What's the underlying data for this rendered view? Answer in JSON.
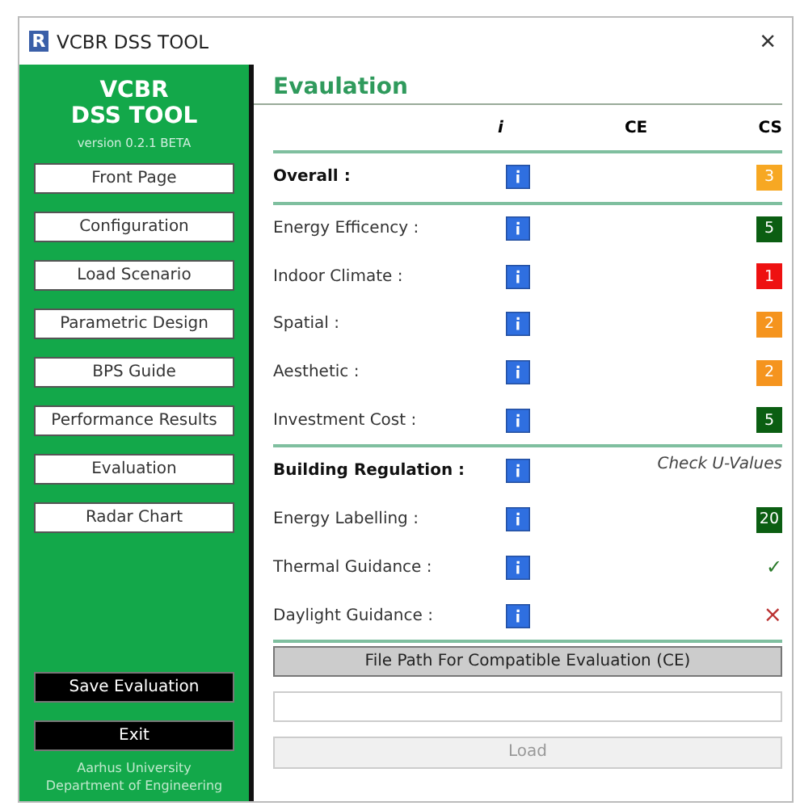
{
  "window": {
    "title": "VCBR DSS TOOL",
    "app_letter": "R",
    "close": "×"
  },
  "sidebar": {
    "title_lines": [
      "VCBR",
      "DSS TOOL"
    ],
    "version": "version 0.2.1 BETA",
    "items": [
      {
        "label": "Front Page"
      },
      {
        "label": "Configuration"
      },
      {
        "label": "Load Scenario"
      },
      {
        "label": "Parametric Design"
      },
      {
        "label": "BPS Guide"
      },
      {
        "label": "Performance Results"
      },
      {
        "label": "Evaluation"
      },
      {
        "label": "Radar Chart"
      }
    ],
    "actions": [
      "Save Evaluation",
      "Exit"
    ],
    "footer": [
      "Aarhus University",
      "Department of Engineering"
    ]
  },
  "evaluation": {
    "heading": "Evaulation",
    "columns": [
      "i",
      "CE",
      "CS"
    ],
    "rows": [
      {
        "label": "Overall :",
        "bold": true,
        "kind": "score",
        "value": "3",
        "color": "#f7a823"
      },
      {
        "label": "Energy Efficency :",
        "bold": false,
        "kind": "score",
        "value": "5",
        "color": "#0b5e12"
      },
      {
        "label": "Indoor Climate :",
        "bold": false,
        "kind": "score",
        "value": "1",
        "color": "#ee1111"
      },
      {
        "label": "Spatial :",
        "bold": false,
        "kind": "score",
        "value": "2",
        "color": "#f5941e"
      },
      {
        "label": "Aesthetic :",
        "bold": false,
        "kind": "score",
        "value": "2",
        "color": "#f5941e"
      },
      {
        "label": "Investment Cost :",
        "bold": false,
        "kind": "score",
        "value": "5",
        "color": "#0b5e12"
      },
      {
        "label": "Building Regulation :",
        "bold": true,
        "kind": "note",
        "value": "Check U-Values"
      },
      {
        "label": "Energy Labelling :",
        "bold": false,
        "kind": "score",
        "value": "20",
        "color": "#0b5e12"
      },
      {
        "label": "Thermal Guidance :",
        "bold": false,
        "kind": "check",
        "value": "✓"
      },
      {
        "label": "Daylight Guidance :",
        "bold": false,
        "kind": "cross",
        "value": "×"
      }
    ],
    "file_button": "File Path For Compatible Evaluation (CE)",
    "load_button": "Load"
  }
}
